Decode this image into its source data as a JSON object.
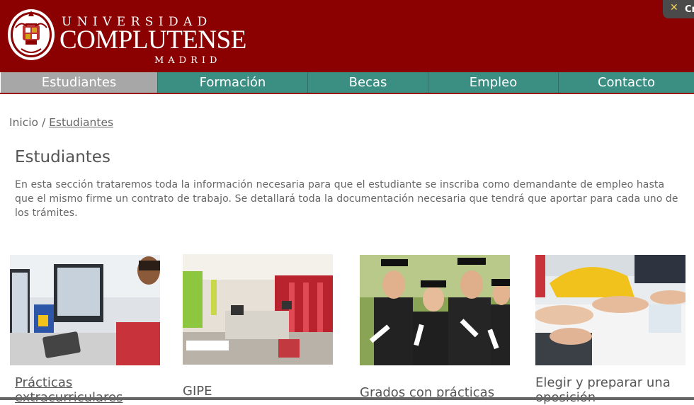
{
  "header": {
    "brand_top": "UNIVERSIDAD",
    "brand_main": "COMPLUTENSE",
    "brand_bottom": "MADRID",
    "cookie_label": "Cr"
  },
  "nav": {
    "items": [
      {
        "label": "Estudiantes",
        "active": true
      },
      {
        "label": "Formación"
      },
      {
        "label": "Becas"
      },
      {
        "label": "Empleo"
      },
      {
        "label": "Contacto"
      }
    ]
  },
  "breadcrumb": {
    "home": "Inicio",
    "separator": "/",
    "current": "Estudiantes"
  },
  "page": {
    "title": "Estudiantes",
    "intro": "En esta sección trataremos toda la información necesaria para que el estudiante se inscriba como demandante de empleo hasta que el mismo firme un contrato de trabajo. Se detallará toda la documentación necesaria que tendrá que aportar para cada uno de los trámites."
  },
  "cards": [
    {
      "label": "Prácticas extracurriculares",
      "image": "computers-office-photo"
    },
    {
      "label": "GIPE",
      "image": "office-interior-photo"
    },
    {
      "label": "Grados con prácticas",
      "image": "graduates-photo"
    },
    {
      "label": "Elegir y preparar una oposición",
      "image": "writing-hands-photo"
    }
  ],
  "colors": {
    "brand_red": "#8b0000",
    "nav_teal": "#3b8f82",
    "nav_active": "#a7a7a7"
  }
}
